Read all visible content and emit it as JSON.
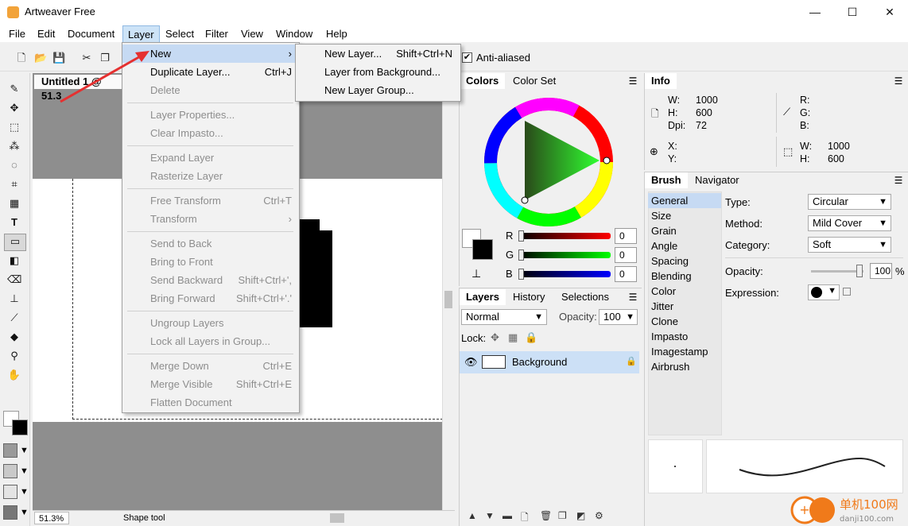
{
  "window": {
    "title": "Artweaver Free",
    "minimize": "—",
    "maximize": "☐",
    "close": "✕"
  },
  "menubar": [
    "File",
    "Edit",
    "Document",
    "Layer",
    "Select",
    "Filter",
    "View",
    "Window",
    "Help"
  ],
  "toolbar": {
    "antialiased_label": "Anti-aliased",
    "antialiased_checked": "✔"
  },
  "document": {
    "tab_title": "Untitled 1 @ 51.3",
    "zoom": "51.3%",
    "status": "Shape tool"
  },
  "layer_menu": {
    "items": [
      {
        "label": "New",
        "shortcut": "",
        "submenu": "›"
      },
      {
        "label": "Duplicate Layer...",
        "shortcut": "Ctrl+J"
      },
      {
        "label": "Delete",
        "shortcut": ""
      },
      {
        "label": "Layer Properties...",
        "shortcut": ""
      },
      {
        "label": "Clear Impasto...",
        "shortcut": ""
      },
      {
        "label": "Expand Layer",
        "shortcut": ""
      },
      {
        "label": "Rasterize Layer",
        "shortcut": ""
      },
      {
        "label": "Free Transform",
        "shortcut": "Ctrl+T"
      },
      {
        "label": "Transform",
        "shortcut": "",
        "submenu": "›"
      },
      {
        "label": "Send to Back",
        "shortcut": ""
      },
      {
        "label": "Bring to Front",
        "shortcut": ""
      },
      {
        "label": "Send Backward",
        "shortcut": "Shift+Ctrl+',"
      },
      {
        "label": "Bring Forward",
        "shortcut": "Shift+Ctrl+'.'"
      },
      {
        "label": "Ungroup Layers",
        "shortcut": ""
      },
      {
        "label": "Lock all Layers in Group...",
        "shortcut": ""
      },
      {
        "label": "Merge Down",
        "shortcut": "Ctrl+E"
      },
      {
        "label": "Merge Visible",
        "shortcut": "Shift+Ctrl+E"
      },
      {
        "label": "Flatten Document",
        "shortcut": ""
      }
    ]
  },
  "new_submenu": [
    {
      "label": "New Layer...",
      "shortcut": "Shift+Ctrl+N"
    },
    {
      "label": "Layer from Background...",
      "shortcut": ""
    },
    {
      "label": "New Layer Group...",
      "shortcut": ""
    }
  ],
  "colors_panel": {
    "tabs": [
      "Colors",
      "Color Set"
    ],
    "channels": [
      {
        "label": "R",
        "value": "0"
      },
      {
        "label": "G",
        "value": "0"
      },
      {
        "label": "B",
        "value": "0"
      }
    ]
  },
  "layers_panel": {
    "tabs": [
      "Layers",
      "History",
      "Selections"
    ],
    "blend_mode": "Normal",
    "opacity_label": "Opacity:",
    "opacity_value": "100",
    "lock_label": "Lock:",
    "layer_name": "Background"
  },
  "info_panel": {
    "title": "Info",
    "w_label": "W:",
    "w_value": "1000",
    "h_label": "H:",
    "h_value": "600",
    "dpi_label": "Dpi:",
    "dpi_value": "72",
    "r_label": "R:",
    "g_label": "G:",
    "b_label": "B:",
    "x_label": "X:",
    "y_label": "Y:",
    "sel_w_label": "W:",
    "sel_w_value": "1000",
    "sel_h_label": "H:",
    "sel_h_value": "600"
  },
  "brush_panel": {
    "tabs": [
      "Brush",
      "Navigator"
    ],
    "categories": [
      "General",
      "Size",
      "Grain",
      "Angle",
      "Spacing",
      "Blending",
      "Color",
      "Jitter",
      "Clone",
      "Impasto",
      "Imagestamp",
      "Airbrush"
    ],
    "type_label": "Type:",
    "type_value": "Circular",
    "method_label": "Method:",
    "method_value": "Mild Cover",
    "category_label": "Category:",
    "category_value": "Soft",
    "opacity_label": "Opacity:",
    "opacity_value": "100",
    "opacity_unit": "%",
    "expression_label": "Expression:"
  },
  "watermark": {
    "text": "单机100网",
    "url": "danji100.com"
  }
}
